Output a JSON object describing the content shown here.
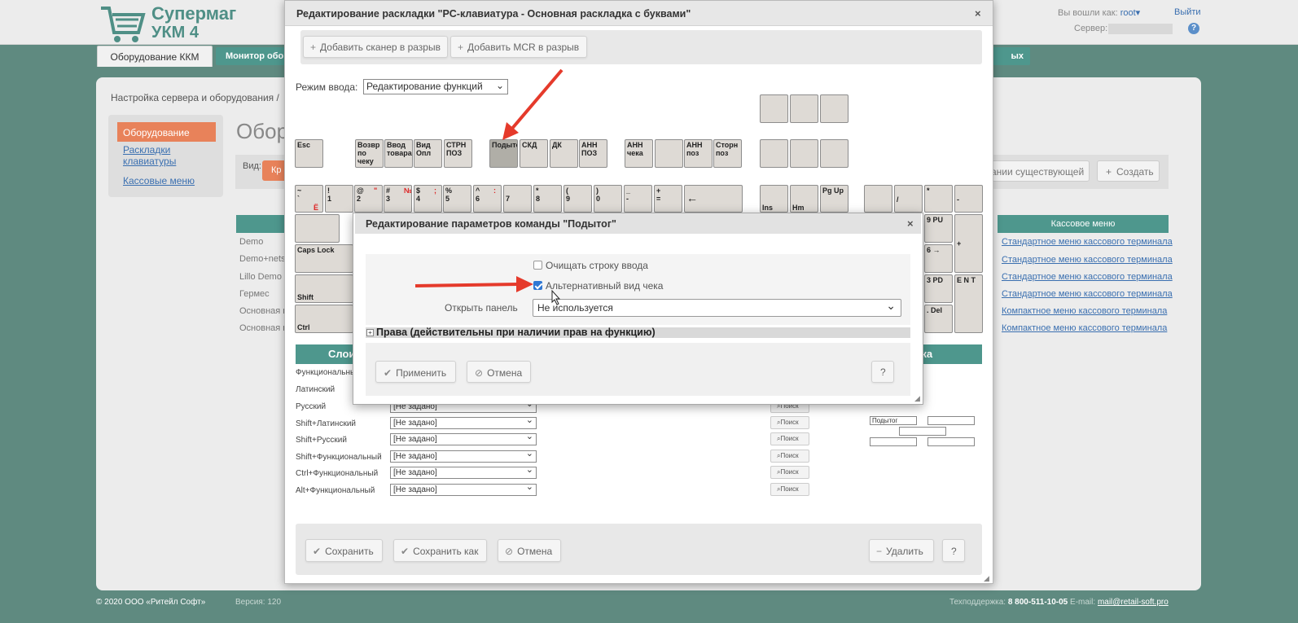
{
  "app": {
    "logo_line1": "Супермаг",
    "logo_line2": "УКМ 4",
    "user_prefix": "Вы вошли как:",
    "user_name": "root",
    "logout": "Выйти",
    "server_label": "Сервер:",
    "help": "?"
  },
  "tabs": {
    "equipment": "Оборудование ККМ",
    "monitor": "Монитор обор",
    "last": "ых"
  },
  "page": {
    "breadcrumb": "Настройка сервера и оборудования  /  ",
    "title": "Обор",
    "view_label": "Вид:",
    "view_btn": "Кр",
    "btn_existing": "ании существующей",
    "btn_create": "Создать",
    "left_menu": {
      "active": "Оборудование",
      "layouts": "Раскладки клавиатуры",
      "menus": "Кассовые меню"
    },
    "list_left": [
      "Demo",
      "Demo+nets",
      "Lillo Demo",
      "Гермес",
      "Основная к",
      "Основная к"
    ],
    "menu_col_header": "Кассовое меню",
    "menu_col": [
      "Стандартное меню кассового терминала",
      "Стандартное меню кассового терминала",
      "Стандартное меню кассового терминала",
      "Стандартное меню кассового терминала",
      "Компактное меню кассового терминала",
      "Компактное меню кассового терминала"
    ]
  },
  "footer": {
    "copyright": "© 2020 ООО «Ритейл Софт»",
    "version": "Версия: 120",
    "support_label": "Техподдержка:",
    "support_phone": "8 800-511-10-05",
    "email_label": "E-mail:",
    "email": "mail@retail-soft.pro"
  },
  "dialog_main": {
    "title": "Редактирование раскладки \"PC-клавиатура - Основная раскладка с буквами\"",
    "close": "×",
    "add_scanner": "Добавить сканер в разрыв",
    "add_mcr": "Добавить MCR в разрыв",
    "mode_label": "Режим ввода:",
    "mode_value": "Редактирование функций",
    "layers_header": "Слои",
    "grid_header": "етка",
    "layers": [
      {
        "label": "Функциональный",
        "value": ""
      },
      {
        "label": "Латинский",
        "value": ""
      },
      {
        "label": "Русский",
        "value": "[Не задано]"
      },
      {
        "label": "Shift+Латинский",
        "value": "[Не задано]"
      },
      {
        "label": "Shift+Русский",
        "value": "[Не задано]"
      },
      {
        "label": "Shift+Функциональный",
        "value": "[Не задано]"
      },
      {
        "label": "Ctrl+Функциональный",
        "value": "[Не задано]"
      },
      {
        "label": "Alt+Функциональный",
        "value": "[Не задано]"
      }
    ],
    "search_label": "Поиск",
    "grid_cell": "Подытог",
    "save": "Сохранить",
    "save_as": "Сохранить как",
    "cancel": "Отмена",
    "delete": "Удалить",
    "help": "?"
  },
  "keys": {
    "esc": "Esc",
    "vozvr": "Возвр по чеку",
    "vvod": "Ввод товара",
    "vid": "Вид Опл",
    "strn": "СТРН ПОЗ",
    "podyt": "Подытог",
    "skd": "СКД",
    "dk": "ДК",
    "ann_poz": "АНН ПОЗ",
    "ann_cheka": "АНН чека",
    "ann_poz2": "АНН поз",
    "storn": "Сторн поз",
    "caps": "Caps Lock",
    "shift": "Shift",
    "ctrl": "Ctrl",
    "ins": "Ins",
    "hm": "Hm",
    "pgup": "Pg Up",
    "n9pu": "9 PU",
    "n6": "6 →",
    "n3pd": "3 PD",
    "ndel": ". Del",
    "ent": "E N T",
    "plus": "+",
    "minus": "-",
    "star": "*",
    "slash": "/",
    "bksp": "←"
  },
  "dialog_sub": {
    "title": "Редактирование параметров команды \"Подытог\"",
    "close": "×",
    "clear_input": "Очищать строку ввода",
    "clear_input_checked": false,
    "alt_receipt": "Альтернативный вид чека",
    "alt_receipt_checked": true,
    "panel_label": "Открыть панель",
    "panel_value": "Не используется",
    "rights": "Права (действительны при наличии прав на функцию)",
    "apply": "Применить",
    "cancel": "Отмена",
    "help": "?"
  },
  "colors": {
    "accent": "#4e978d",
    "active": "#e8825a",
    "link": "#3a6fb0",
    "arrow": "#e53a2b"
  }
}
